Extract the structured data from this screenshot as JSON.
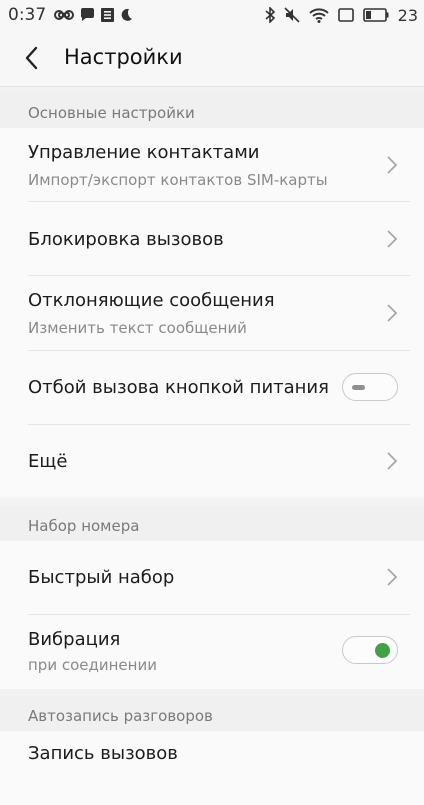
{
  "status_bar": {
    "time": "0:37",
    "battery_level": "23",
    "left_icons": [
      "infinity-icon",
      "chat-bubble-icon",
      "list-notification-icon",
      "moon-icon"
    ],
    "right_icons": [
      "bluetooth-icon",
      "mute-icon",
      "wifi-icon",
      "screen-rotate-icon",
      "battery-icon"
    ]
  },
  "app_bar": {
    "title": "Настройки",
    "back_icon": "chevron-left-icon"
  },
  "sections": {
    "basic": {
      "header": "Основные настройки",
      "contacts": {
        "label": "Управление контактами",
        "sub": "Импорт/экспорт контактов SIM-карты"
      },
      "block": {
        "label": "Блокировка вызовов"
      },
      "reject": {
        "label": "Отклоняющие сообщения",
        "sub": "Изменить текст сообщений"
      },
      "power_end": {
        "label": "Отбой вызова кнопкой питания",
        "toggle_on": false
      },
      "more": {
        "label": "Ещё"
      }
    },
    "dial": {
      "header": "Набор номера",
      "speed": {
        "label": "Быстрый набор"
      },
      "vibration": {
        "label": "Вибрация",
        "sub": "при соединении",
        "toggle_on": true
      }
    },
    "autorecord": {
      "header": "Автозапись разговоров",
      "record": {
        "label": "Запись вызовов"
      }
    }
  },
  "colors": {
    "accent_green": "#43a047",
    "background": "#f2f2f2",
    "row_background": "#fafafa"
  }
}
